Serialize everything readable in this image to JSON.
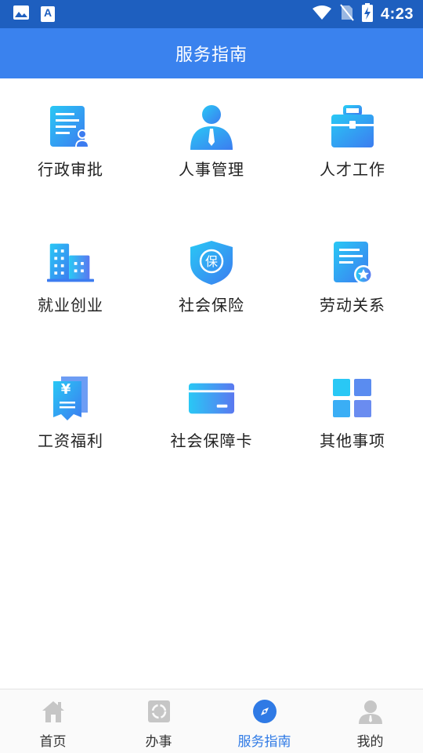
{
  "status_bar": {
    "time": "4:23",
    "small_icon_letter": "A"
  },
  "app_bar": {
    "title": "服务指南"
  },
  "colors": {
    "status_bar": "#1e5fbf",
    "app_bar": "#3a82ee",
    "accent": "#2f7ae5",
    "icon_gradient_start": "#29c8f5",
    "icon_gradient_end": "#3c7cf0"
  },
  "services": [
    {
      "label": "行政审批",
      "icon": "document-approval-icon",
      "badge": ""
    },
    {
      "label": "人事管理",
      "icon": "person-tie-icon",
      "badge": ""
    },
    {
      "label": "人才工作",
      "icon": "briefcase-icon",
      "badge": ""
    },
    {
      "label": "就业创业",
      "icon": "buildings-icon",
      "badge": ""
    },
    {
      "label": "社会保险",
      "icon": "shield-insurance-icon",
      "badge": "保"
    },
    {
      "label": "劳动关系",
      "icon": "document-star-icon",
      "badge": ""
    },
    {
      "label": "工资福利",
      "icon": "yen-receipt-icon",
      "badge": "¥"
    },
    {
      "label": "社会保障卡",
      "icon": "card-icon",
      "badge": ""
    },
    {
      "label": "其他事项",
      "icon": "grid-apps-icon",
      "badge": ""
    }
  ],
  "bottom_nav": [
    {
      "label": "首页",
      "icon": "home-icon",
      "active": false
    },
    {
      "label": "办事",
      "icon": "tasks-icon",
      "active": false
    },
    {
      "label": "服务指南",
      "icon": "compass-icon",
      "active": true
    },
    {
      "label": "我的",
      "icon": "user-icon",
      "active": false
    }
  ]
}
